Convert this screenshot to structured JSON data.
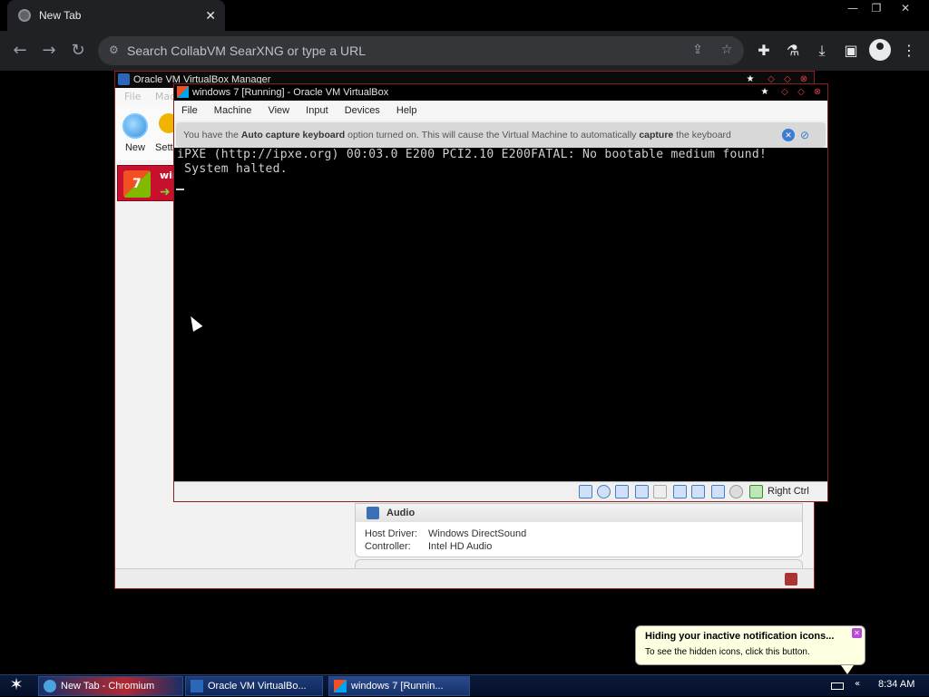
{
  "browser": {
    "tab_title": "New Tab",
    "omnibox_placeholder": "Search CollabVM SearXNG or type a URL",
    "window_controls": [
      "—",
      "❐",
      "✕"
    ]
  },
  "vbox_manager": {
    "title": "Oracle VM VirtualBox Manager",
    "menu_partial": [
      "File",
      "Mac"
    ],
    "toolbar": {
      "new_label": "New",
      "settings_label_partial": "Sett"
    },
    "vm_list_item": {
      "name_partial": "win",
      "badge": "7"
    },
    "audio": {
      "header": "Audio",
      "host_driver_key": "Host Driver:",
      "host_driver_value": "Windows DirectSound",
      "controller_key": "Controller:",
      "controller_value": "Intel HD Audio"
    }
  },
  "vm_window": {
    "title": "windows 7 [Running] - Oracle VM VirtualBox",
    "menu": [
      "File",
      "Machine",
      "View",
      "Input",
      "Devices",
      "Help"
    ],
    "banner": {
      "pre": "You have the ",
      "bold1": "Auto capture keyboard",
      "mid": " option turned on. This will cause the Virtual Machine to automatically ",
      "bold2": "capture",
      "post": " the keyboard"
    },
    "console_lines": [
      "iPXE (http://ipxe.org) 00:03.0 E200 PCI2.10 E200FATAL: No bootable medium found!",
      " System halted."
    ],
    "host_key": "Right Ctrl"
  },
  "notification": {
    "title": "Hiding your inactive notification icons...",
    "text": "To see the hidden icons, click this button."
  },
  "taskbar": {
    "tasks": [
      "New Tab - Chromium",
      "Oracle VM VirtualBo...",
      "windows 7 [Runnin..."
    ],
    "clock": "8:34 AM"
  }
}
